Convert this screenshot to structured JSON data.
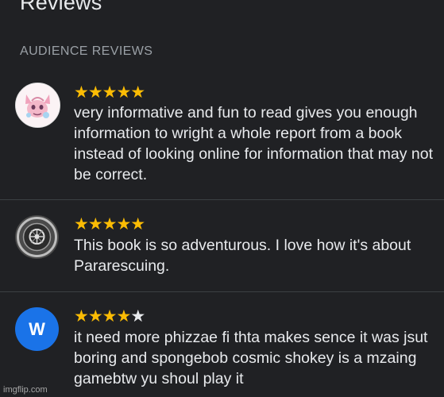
{
  "header": {
    "title": "Reviews"
  },
  "section": {
    "label": "AUDIENCE REVIEWS"
  },
  "reviews": [
    {
      "rating": 5,
      "stars_text": "★★★★★",
      "empty_stars_text": "",
      "text": "very informative and fun to read gives you enough information to wright a whole report from a book instead of looking online for information that may not be correct.",
      "avatar": "pink-creature-avatar"
    },
    {
      "rating": 5,
      "stars_text": "★★★★★",
      "empty_stars_text": "",
      "text": "This book is so adventurous. I love how it's about Pararescuing.",
      "avatar": "emblem-avatar"
    },
    {
      "rating": 4,
      "stars_text": "★★★★",
      "empty_stars_text": "★",
      "text": "it need more phizzae fi thta makes sence it was jsut boring and spongebob cosmic shokey is a mzaing gamebtw yu shoul play it",
      "avatar": "letter-avatar",
      "avatar_letter": "W"
    }
  ],
  "colors": {
    "background": "#202124",
    "star": "#fbbc04",
    "avatar_blue": "#1a73e8",
    "divider": "#3c4043"
  },
  "watermark": "imgflip.com"
}
